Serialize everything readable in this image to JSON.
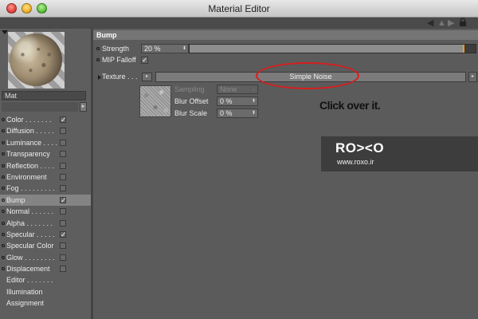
{
  "window": {
    "title": "Material Editor"
  },
  "material": {
    "name": "Mat"
  },
  "channels": [
    {
      "label": "Color . . . . . . .",
      "has_dot": true,
      "checked": true,
      "has_checkbox": true,
      "active": false
    },
    {
      "label": "Diffusion . . . . .",
      "has_dot": true,
      "checked": false,
      "has_checkbox": true,
      "active": false
    },
    {
      "label": "Luminance . . . .",
      "has_dot": true,
      "checked": false,
      "has_checkbox": true,
      "active": false
    },
    {
      "label": "Transparency",
      "has_dot": true,
      "checked": false,
      "has_checkbox": true,
      "active": false
    },
    {
      "label": "Reflection . . . .",
      "has_dot": true,
      "checked": false,
      "has_checkbox": true,
      "active": false
    },
    {
      "label": "Environment",
      "has_dot": true,
      "checked": false,
      "has_checkbox": true,
      "active": false
    },
    {
      "label": "Fog . . . . . . . . .",
      "has_dot": true,
      "checked": false,
      "has_checkbox": true,
      "active": false
    },
    {
      "label": "Bump",
      "has_dot": true,
      "checked": true,
      "has_checkbox": true,
      "active": true
    },
    {
      "label": "Normal . . . . . .",
      "has_dot": true,
      "checked": false,
      "has_checkbox": true,
      "active": false
    },
    {
      "label": "Alpha . . . . . . .",
      "has_dot": true,
      "checked": false,
      "has_checkbox": true,
      "active": false
    },
    {
      "label": "Specular . . . . .",
      "has_dot": true,
      "checked": true,
      "has_checkbox": true,
      "active": false
    },
    {
      "label": "Specular Color",
      "has_dot": true,
      "checked": false,
      "has_checkbox": true,
      "active": false
    },
    {
      "label": "Glow . . . . . . . .",
      "has_dot": true,
      "checked": false,
      "has_checkbox": true,
      "active": false
    },
    {
      "label": "Displacement",
      "has_dot": true,
      "checked": false,
      "has_checkbox": true,
      "active": false
    },
    {
      "label": "Editor . . . . . . .",
      "has_dot": false,
      "checked": false,
      "has_checkbox": false,
      "active": false
    },
    {
      "label": "Illumination",
      "has_dot": false,
      "checked": false,
      "has_checkbox": false,
      "active": false
    },
    {
      "label": "Assignment",
      "has_dot": false,
      "checked": false,
      "has_checkbox": false,
      "active": false
    }
  ],
  "bump": {
    "section_title": "Bump",
    "strength_label": "Strength",
    "strength_value": "20 %",
    "strength_fraction": 0.2,
    "mip_label": "MIP Falloff",
    "mip_checked": true,
    "texture_label": "Texture . . .",
    "texture_shader": "Simple Noise",
    "sampling_label": "Sampling",
    "sampling_value": "None",
    "blur_offset_label": "Blur Offset",
    "blur_offset_value": "0 %",
    "blur_scale_label": "Blur Scale",
    "blur_scale_value": "0 %"
  },
  "annotation": {
    "text": "Click over it."
  },
  "watermark": {
    "logo": "RO><O",
    "url": "www.roxo.ir"
  },
  "icons": {
    "toolbar": [
      "nav-back-icon",
      "nav-up-icon",
      "nav-forward-icon",
      "lock-icon"
    ],
    "check_glyph": "✓"
  },
  "colors": {
    "accent": "#ff9a1a",
    "annotation": "#d81d1d",
    "active_row": "#848484"
  }
}
